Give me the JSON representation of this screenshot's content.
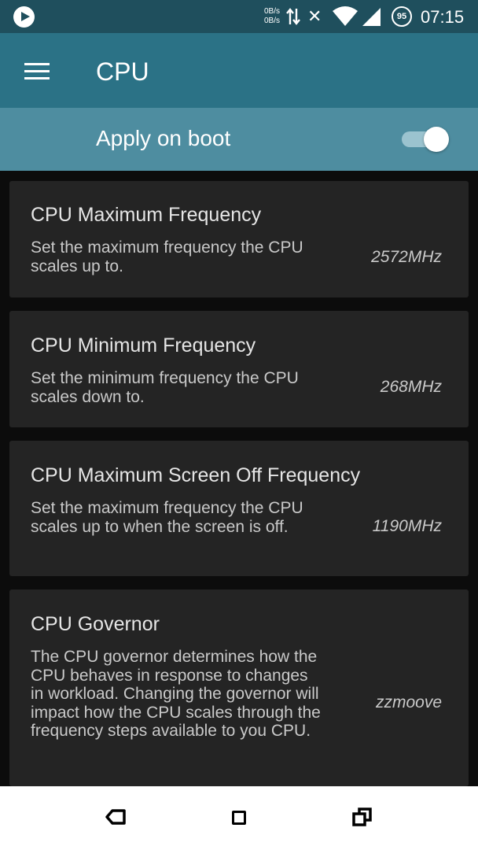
{
  "status_bar": {
    "net_up": "0B/s",
    "net_down": "0B/s",
    "battery": "95",
    "time": "07:15"
  },
  "app_bar": {
    "title": "CPU"
  },
  "boot_row": {
    "label": "Apply on boot",
    "toggle_on": true
  },
  "cards": [
    {
      "title": "CPU Maximum Frequency",
      "description": "Set the maximum frequency the CPU scales up to.",
      "value": "2572MHz"
    },
    {
      "title": "CPU Minimum Frequency",
      "description": "Set the minimum frequency the CPU scales down to.",
      "value": "268MHz"
    },
    {
      "title": "CPU Maximum Screen Off Frequency",
      "description": "Set the maximum frequency the CPU scales up to when the screen is off.",
      "value": "1190MHz"
    },
    {
      "title": "CPU Governor",
      "description": "The CPU governor determines how the CPU behaves in response to changes in workload. Changing the governor will impact how the CPU scales through the frequency steps available to you CPU.",
      "value": "zzmoove"
    }
  ],
  "colors": {
    "status_bar": "#1f4f5d",
    "app_bar": "#2b7286",
    "boot_row": "#4e8da0",
    "card": "#242424",
    "background": "#0c0c0c"
  },
  "icons": {
    "status_left": "play-icon",
    "data": "arrows-icon",
    "no_sim": "x-icon",
    "wifi": "wifi-icon",
    "signal": "signal-icon",
    "battery": "battery-icon",
    "menu": "menu-icon",
    "nav": [
      "back-icon",
      "home-icon",
      "recent-apps-icon"
    ]
  }
}
